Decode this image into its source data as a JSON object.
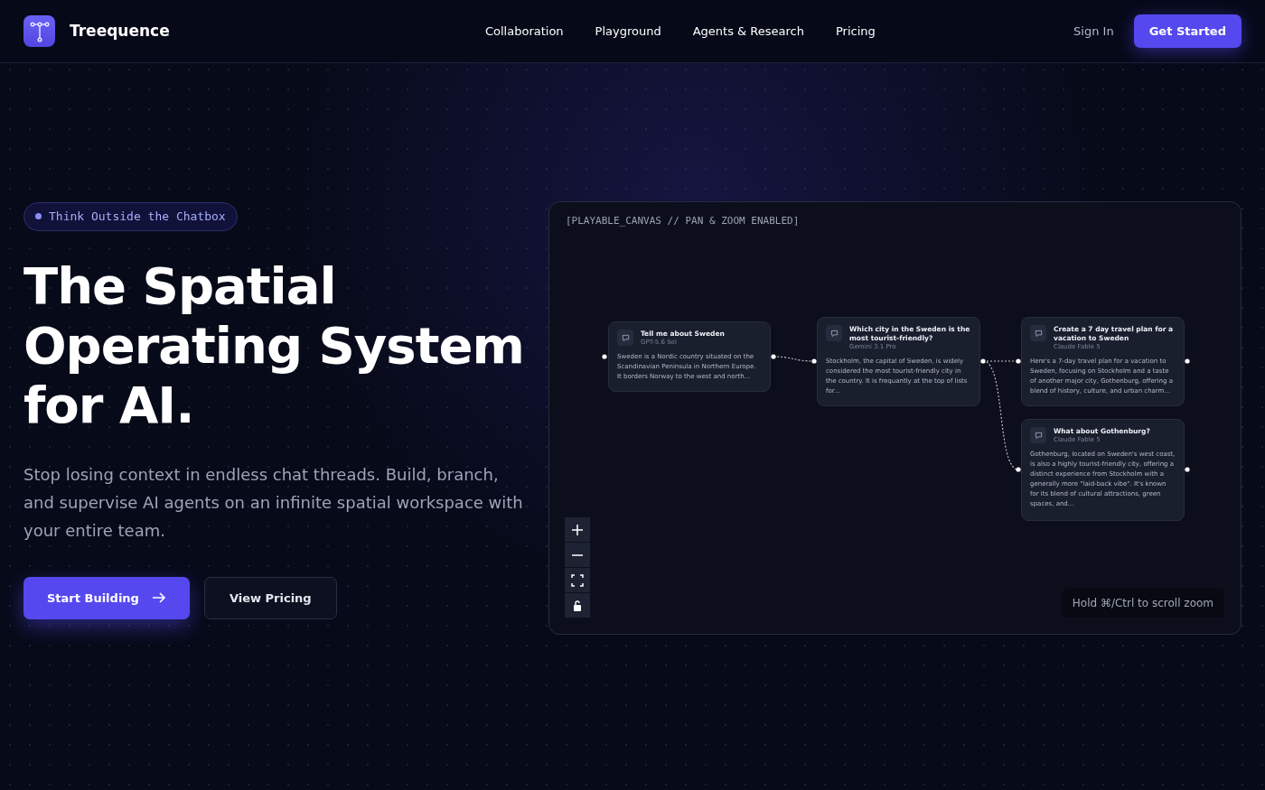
{
  "brand": {
    "name": "Treequence"
  },
  "nav": [
    {
      "label": "Collaboration"
    },
    {
      "label": "Playground"
    },
    {
      "label": "Agents & Research"
    },
    {
      "label": "Pricing"
    }
  ],
  "auth": {
    "sign_in": "Sign In",
    "get_started": "Get Started"
  },
  "hero": {
    "badge": "Think Outside the Chatbox",
    "title_lines": [
      "The Spatial",
      "Operating System",
      "for AI."
    ],
    "subtitle": "Stop losing context in endless chat threads. Build, branch, and supervise AI agents on an infinite spatial workspace with your entire team.",
    "primary_button": "Start Building",
    "secondary_button": "View Pricing"
  },
  "canvas": {
    "header": "[PLAYABLE_CANVAS // PAN & ZOOM ENABLED]",
    "hint": "Hold ⌘/Ctrl to scroll zoom",
    "nodes": [
      {
        "title": "Tell me about Sweden",
        "model": "GPT-5.6 Sol",
        "body": "Sweden is a Nordic country situated on the Scandinavian Peninsula in Northern Europe. It borders Norway to the west and north..."
      },
      {
        "title": "Which city in the Sweden is the most tourist-friendly?",
        "model": "Gemini 3.1 Pro",
        "body": "Stockholm, the capital of Sweden, is widely considered the most tourist-friendly city in the country. It is frequantly at the top of lists for..."
      },
      {
        "title": "Create a 7 day travel plan for a vacation to Sweden",
        "model": "Claude Fable 5",
        "body": "Here's a 7-day travel plan for a vacation to Sweden, focusing on Stockholm and a taste of another major city, Gothenburg, offering a blend of history, culture, and urban charm..."
      },
      {
        "title": "What about Gothenburg?",
        "model": "Claude Fable 5",
        "body": "Gothenburg, located on Sweden's west coast, is also a highly tourist-friendly city, offering a distinct experience from Stockholm with a generally more \"laid-back vibe\". It's known for its blend of cultural attractions, green spaces, and..."
      }
    ]
  }
}
